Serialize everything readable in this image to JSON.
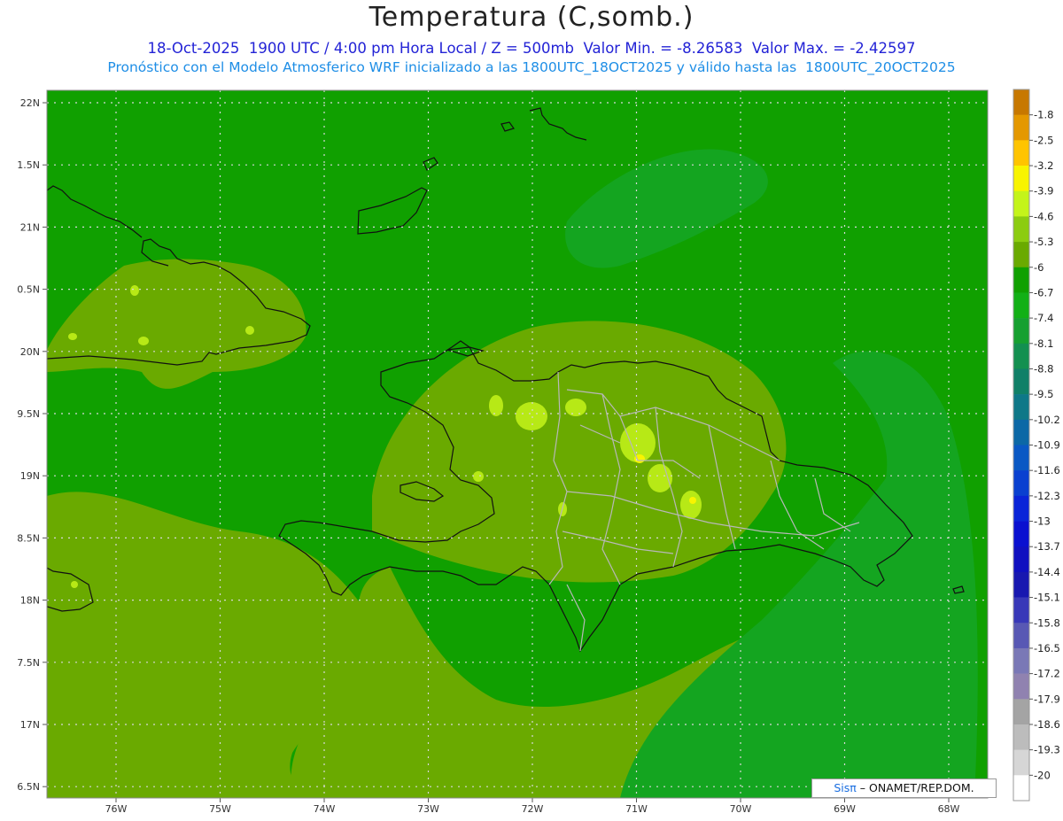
{
  "header": {
    "title": "Temperatura (C,somb.)",
    "subtitle_line1": "18-Oct-2025  1900 UTC / 4:00 pm Hora Local / Z = 500mb  Valor Min. = -8.26583  Valor Max. = -2.42597",
    "subtitle_line2": "Pronóstico con el Modelo Atmosferico WRF inicializado a las 1800UTC_18OCT2025 y válido hasta las  1800UTC_20OCT2025"
  },
  "axes": {
    "lon_labels": [
      "76W",
      "75W",
      "74W",
      "73W",
      "72W",
      "71W",
      "70W",
      "69W",
      "68W"
    ],
    "lat_labels": [
      "22N",
      "1.5N",
      "21N",
      "0.5N",
      "20N",
      "9.5N",
      "19N",
      "8.5N",
      "18N",
      "7.5N",
      "17N",
      "6.5N"
    ]
  },
  "colorbar": {
    "labels": [
      "-1.8",
      "-2.5",
      "-3.2",
      "-3.9",
      "-4.6",
      "-5.3",
      "-6",
      "-6.7",
      "-7.4",
      "-8.1",
      "-8.8",
      "-9.5",
      "-10.2",
      "-10.9",
      "-11.6",
      "-12.3",
      "-13",
      "-13.7",
      "-14.4",
      "-15.1",
      "-15.8",
      "-16.5",
      "-17.2",
      "-17.9",
      "-18.6",
      "-19.3",
      "-20"
    ],
    "colors": [
      "#c77800",
      "#e49800",
      "#ffc400",
      "#f8f400",
      "#c4f41a",
      "#8ccc10",
      "#6aaa00",
      "#10a000",
      "#12b016",
      "#16a030",
      "#139050",
      "#108068",
      "#0e7888",
      "#0c68a6",
      "#0a58c4",
      "#0a40d0",
      "#0a24d8",
      "#0a10d0",
      "#1010c0",
      "#1818b0",
      "#3838b8",
      "#5858b4",
      "#7a78b6",
      "#9082b0",
      "#a4a4a4",
      "#bcbcbc",
      "#d6d6d6",
      "#ffffff"
    ]
  },
  "map": {
    "background_color": "#10a000",
    "warm_zone_color": "#6aaa00",
    "cool_zone_color": "#14a520",
    "hotspot_color": "#c4f41a",
    "coast_color": "#111111",
    "province_color": "#b8b8b8"
  },
  "footer": {
    "brand": "Sisπ",
    "credit": "– ONAMET/REP.DOM."
  }
}
